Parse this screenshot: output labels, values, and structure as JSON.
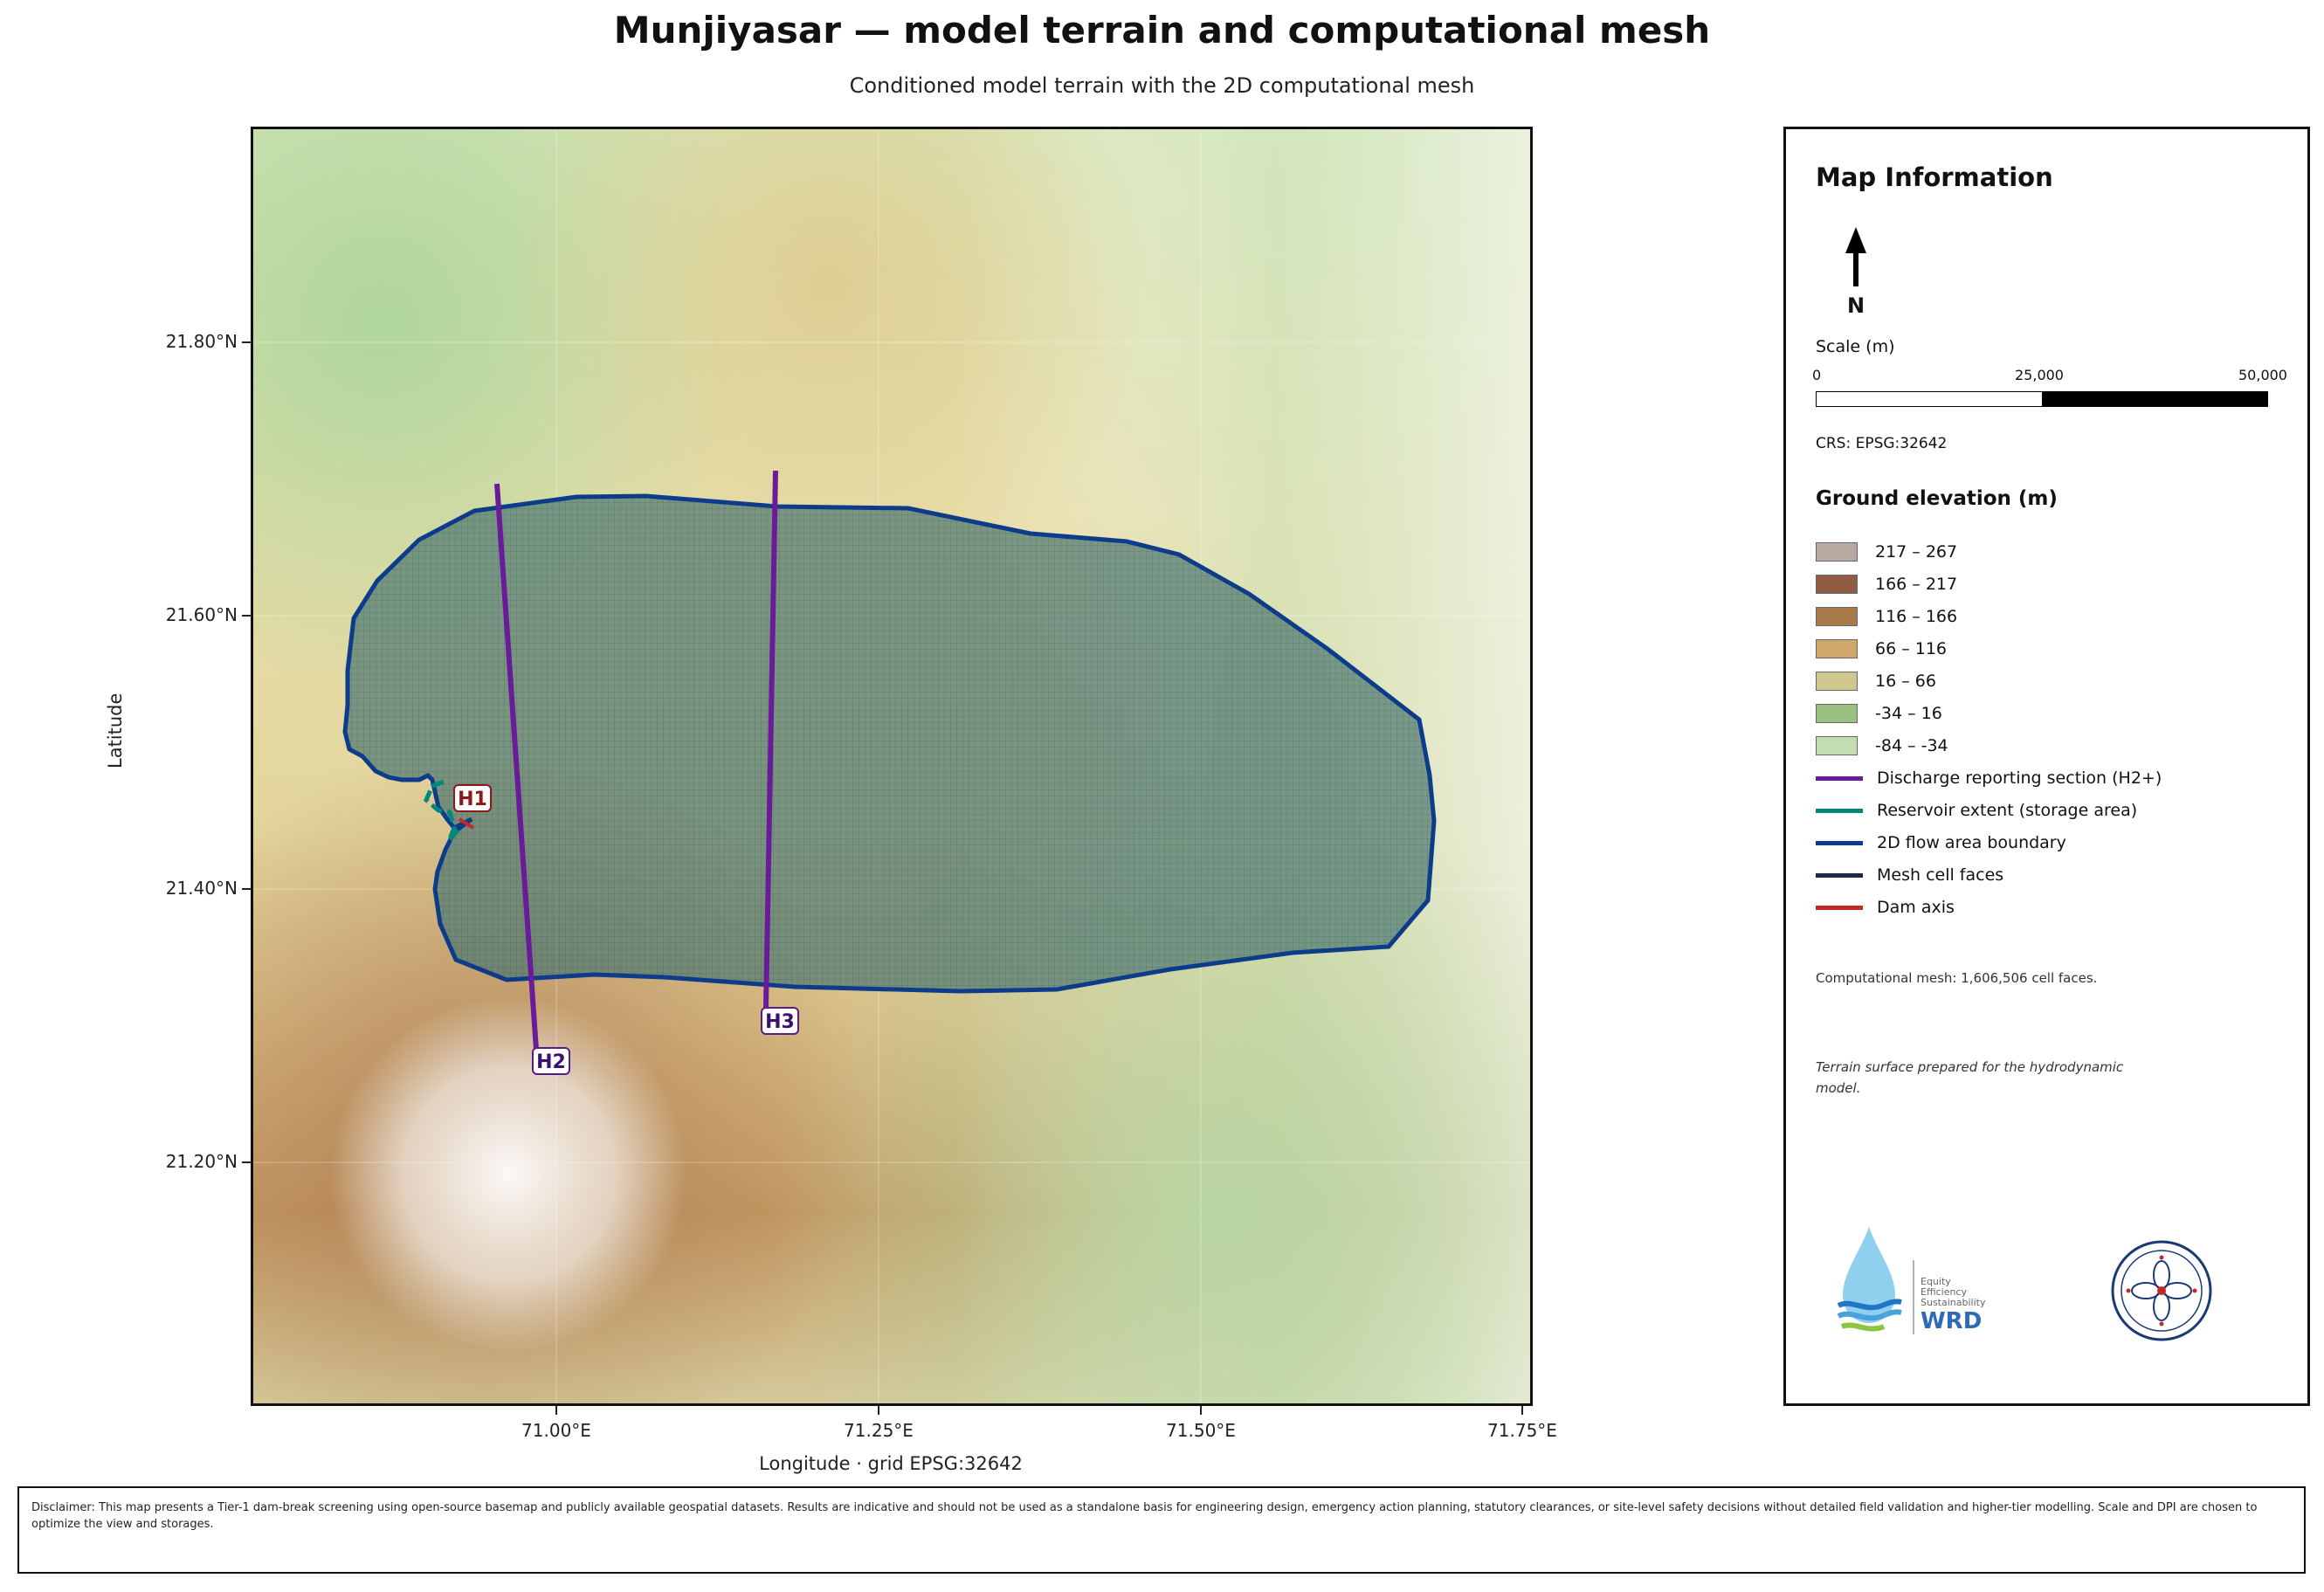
{
  "title": "Munjiyasar — model terrain and computational mesh",
  "subtitle": "Conditioned model terrain with the 2D computational mesh",
  "axes": {
    "ylabel": "Latitude",
    "xlabel": "Longitude   ·   grid EPSG:32642",
    "yticks": [
      "21.80°N",
      "21.60°N",
      "21.40°N",
      "21.20°N"
    ],
    "xticks": [
      "71.00°E",
      "71.25°E",
      "71.50°E",
      "71.75°E"
    ]
  },
  "map_labels": {
    "h1": "H1",
    "h2": "H2",
    "h3": "H3"
  },
  "panel": {
    "title": "Map Information",
    "north": "N",
    "scale_title": "Scale (m)",
    "scale_labels": [
      "0",
      "25,000",
      "50,000"
    ],
    "crs": "CRS: EPSG:32642",
    "elevation_title": "Ground elevation (m)",
    "elevation_classes": [
      {
        "label": "217 – 267",
        "color": "#b9aaa1"
      },
      {
        "label": "166 – 217",
        "color": "#8e5d44"
      },
      {
        "label": "116 – 166",
        "color": "#a87a4a"
      },
      {
        "label": "66 – 116",
        "color": "#cfa76a"
      },
      {
        "label": "16 – 66",
        "color": "#cfc78e"
      },
      {
        "label": "-34 – 16",
        "color": "#9cc083"
      },
      {
        "label": "-84 – -34",
        "color": "#c3ddb0"
      }
    ],
    "line_legend": [
      {
        "label": "Discharge reporting section (H2+)",
        "color": "#6a1b9a"
      },
      {
        "label": "Reservoir extent (storage area)",
        "color": "#00897b"
      },
      {
        "label": "2D flow area boundary",
        "color": "#0d3c8c"
      },
      {
        "label": "Mesh cell faces",
        "color": "#1a2a44"
      },
      {
        "label": "Dam axis",
        "color": "#c62828"
      }
    ],
    "mesh_note": "Computational mesh: 1,606,506 cell faces.",
    "terrain_note": "Terrain surface prepared for the hydrodynamic model.",
    "logo_text": [
      "Equity",
      "Efficiency",
      "Sustainability",
      "WRD"
    ]
  },
  "disclaimer": "Disclaimer: This map presents a Tier-1 dam-break screening using open-source basemap and publicly available geospatial datasets. Results are indicative and should not be used as a standalone basis for engineering design, emergency action planning, statutory clearances, or site-level safety decisions without detailed field validation and higher-tier modelling. Scale and DPI are chosen to optimize the view and storages."
}
